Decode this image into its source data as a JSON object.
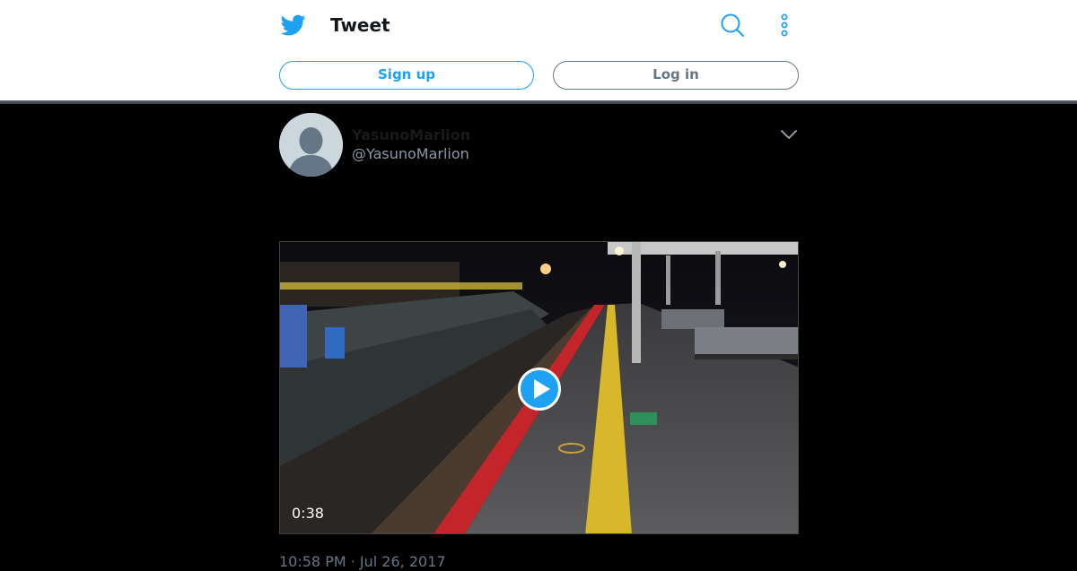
{
  "header": {
    "title": "Tweet",
    "logo_icon": "twitter-bird-icon",
    "search_icon": "search-icon",
    "more_icon": "more-vertical-icon",
    "signup_label": "Sign up",
    "login_label": "Log in"
  },
  "tweet": {
    "display_name": "YasunoMarlion",
    "handle": "@YasunoMarlion",
    "menu_icon": "chevron-down-icon",
    "video": {
      "duration": "0:38",
      "play_icon": "play-icon"
    },
    "timestamp": "10:58 PM · Jul 26, 2017"
  },
  "colors": {
    "accent": "#1da1f2",
    "secondary_text": "#657786",
    "handle_text": "#8899a6"
  }
}
